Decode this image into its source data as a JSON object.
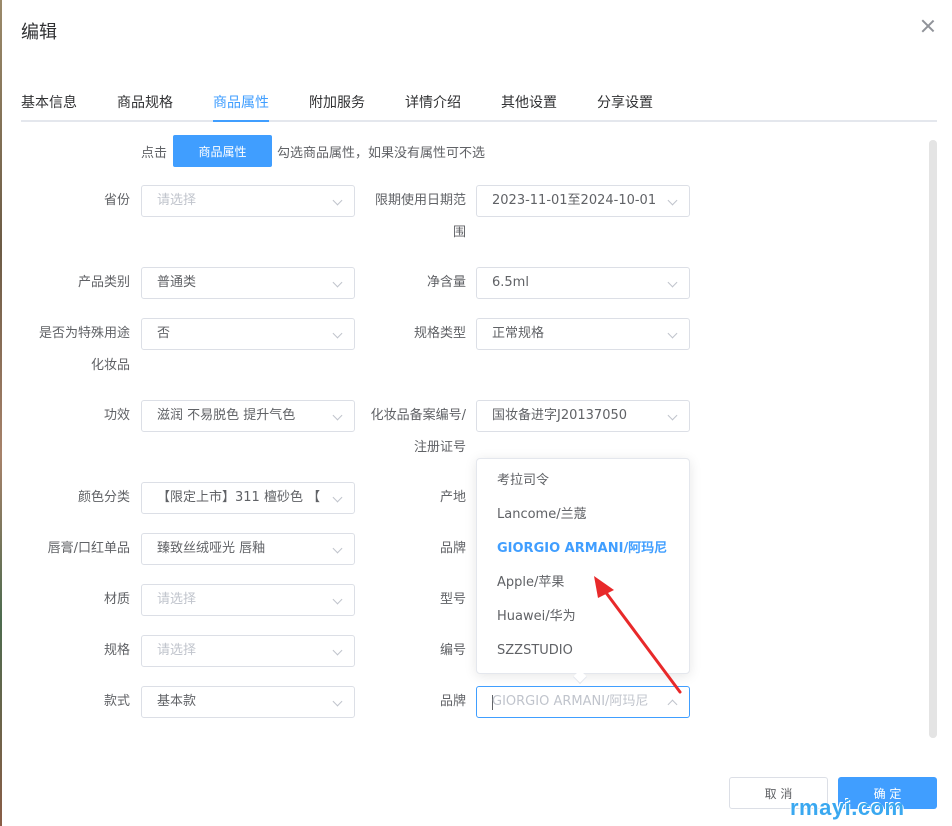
{
  "dialog": {
    "title": "编辑"
  },
  "tabs": [
    {
      "label": "基本信息"
    },
    {
      "label": "商品规格"
    },
    {
      "label": "商品属性"
    },
    {
      "label": "附加服务"
    },
    {
      "label": "详情介绍"
    },
    {
      "label": "其他设置"
    },
    {
      "label": "分享设置"
    }
  ],
  "active_tab": "商品属性",
  "hint": {
    "prefix": "点击",
    "button_label": "商品属性",
    "suffix": "勾选商品属性，如果没有属性可不选"
  },
  "left_fields": [
    {
      "label": "省份",
      "value": "请选择",
      "placeholder": true
    },
    {
      "label": "产品类别",
      "value": "普通类"
    },
    {
      "label_line1": "是否为特殊用途",
      "label_line2": "化妆品",
      "value": "否"
    },
    {
      "label": "功效",
      "value": "滋润 不易脱色 提升气色"
    },
    {
      "label": "颜色分类",
      "value": "【限定上市】311 檀砂色 【限"
    },
    {
      "label": "唇膏/口红单品",
      "value": "臻致丝绒哑光 唇釉"
    },
    {
      "label": "材质",
      "value": "请选择",
      "placeholder": true
    },
    {
      "label": "规格",
      "value": "请选择",
      "placeholder": true
    },
    {
      "label": "款式",
      "value": "基本款"
    }
  ],
  "right_fields": [
    {
      "label_line1": "限期使用日期范",
      "label_line2": "围",
      "value": "2023-11-01至2024-10-01"
    },
    {
      "label": "净含量",
      "value": "6.5ml"
    },
    {
      "label": "规格类型",
      "value": "正常规格"
    },
    {
      "label_line1": "化妆品备案编号/",
      "label_line2": "注册证号",
      "value": "国妆备进字J20137050"
    },
    {
      "label": "产地"
    },
    {
      "label": "品牌"
    },
    {
      "label": "型号"
    },
    {
      "label": "编号"
    },
    {
      "label": "品牌",
      "value": "GIORGIO ARMANI/阿玛尼",
      "placeholder": true,
      "focused": true
    }
  ],
  "brand_dropdown": {
    "options": [
      "考拉司令",
      "Lancome/兰蔻",
      "GIORGIO ARMANI/阿玛尼",
      "Apple/苹果",
      "Huawei/华为",
      "SZZSTUDIO"
    ],
    "selected": "GIORGIO ARMANI/阿玛尼"
  },
  "footer": {
    "cancel_label": "取 消",
    "ok_label": "确 定"
  },
  "watermark": "rmayi.com",
  "colors": {
    "primary": "#409eff",
    "annotation_arrow": "#e8292a"
  }
}
